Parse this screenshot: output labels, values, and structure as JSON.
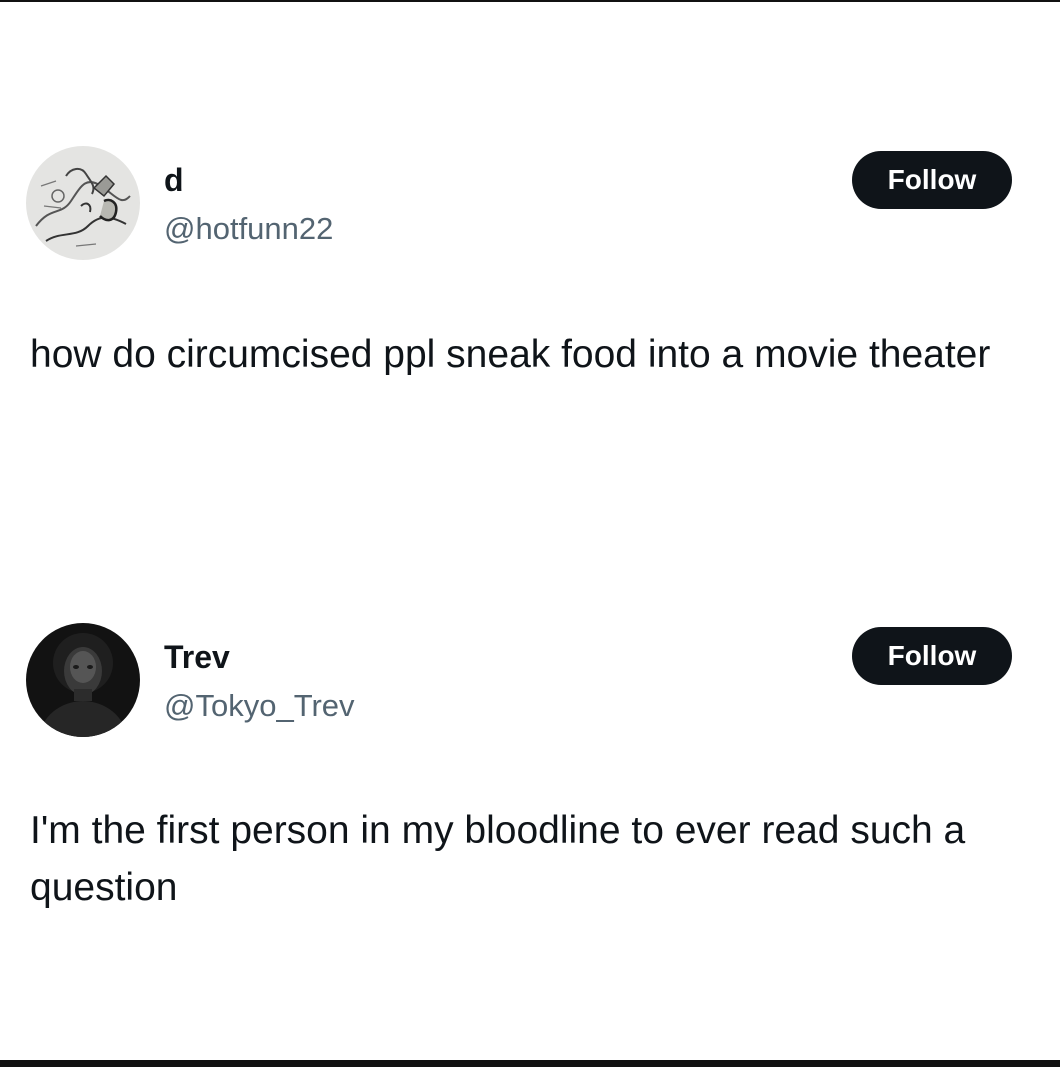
{
  "tweets": [
    {
      "display_name": "d",
      "handle": "@hotfunn22",
      "follow_label": "Follow",
      "text": "how do circumcised ppl sneak food into a movie theater",
      "avatar": "sketch-drawing-avatar"
    },
    {
      "display_name": "Trev",
      "handle": "@Tokyo_Trev",
      "follow_label": "Follow",
      "text": "I'm the first person in my bloodline to ever read such a question",
      "avatar": "dark-portrait-avatar"
    }
  ],
  "colors": {
    "text": "#0f1419",
    "handle": "#536471",
    "button_bg": "#0f1419",
    "button_text": "#ffffff",
    "background": "#ffffff"
  }
}
